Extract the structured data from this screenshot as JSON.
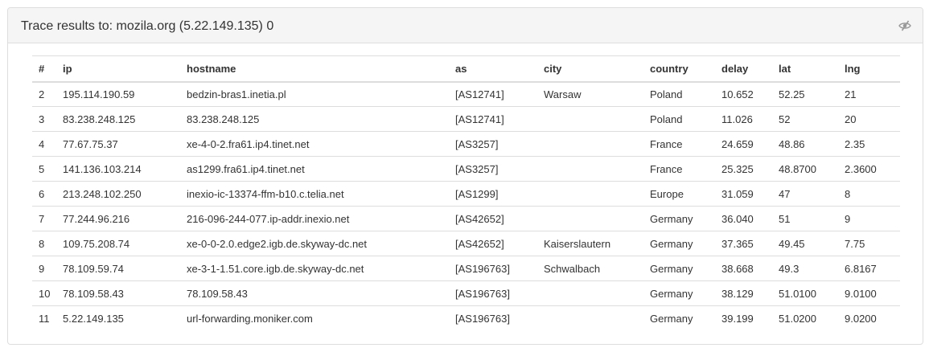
{
  "panel": {
    "title": "Trace results to: mozila.org (5.22.149.135) 0",
    "toggle_icon": "eye-slash-icon"
  },
  "table": {
    "columns": [
      "#",
      "ip",
      "hostname",
      "as",
      "city",
      "country",
      "delay",
      "lat",
      "lng"
    ],
    "rows": [
      [
        "2",
        "195.114.190.59",
        "bedzin-bras1.inetia.pl",
        "[AS12741]",
        "Warsaw",
        "Poland",
        "10.652",
        "52.25",
        "21"
      ],
      [
        "3",
        "83.238.248.125",
        "83.238.248.125",
        "[AS12741]",
        "",
        "Poland",
        "11.026",
        "52",
        "20"
      ],
      [
        "4",
        "77.67.75.37",
        "xe-4-0-2.fra61.ip4.tinet.net",
        "[AS3257]",
        "",
        "France",
        "24.659",
        "48.86",
        "2.35"
      ],
      [
        "5",
        "141.136.103.214",
        "as1299.fra61.ip4.tinet.net",
        "[AS3257]",
        "",
        "France",
        "25.325",
        "48.8700",
        "2.3600"
      ],
      [
        "6",
        "213.248.102.250",
        "inexio-ic-13374-ffm-b10.c.telia.net",
        "[AS1299]",
        "",
        "Europe",
        "31.059",
        "47",
        "8"
      ],
      [
        "7",
        "77.244.96.216",
        "216-096-244-077.ip-addr.inexio.net",
        "[AS42652]",
        "",
        "Germany",
        "36.040",
        "51",
        "9"
      ],
      [
        "8",
        "109.75.208.74",
        "xe-0-0-2.0.edge2.igb.de.skyway-dc.net",
        "[AS42652]",
        "Kaiserslautern",
        "Germany",
        "37.365",
        "49.45",
        "7.75"
      ],
      [
        "9",
        "78.109.59.74",
        "xe-3-1-1.51.core.igb.de.skyway-dc.net",
        "[AS196763]",
        "Schwalbach",
        "Germany",
        "38.668",
        "49.3",
        "6.8167"
      ],
      [
        "10",
        "78.109.58.43",
        "78.109.58.43",
        "[AS196763]",
        "",
        "Germany",
        "38.129",
        "51.0100",
        "9.0100"
      ],
      [
        "11",
        "5.22.149.135",
        "url-forwarding.moniker.com",
        "[AS196763]",
        "",
        "Germany",
        "39.199",
        "51.0200",
        "9.0200"
      ]
    ]
  }
}
